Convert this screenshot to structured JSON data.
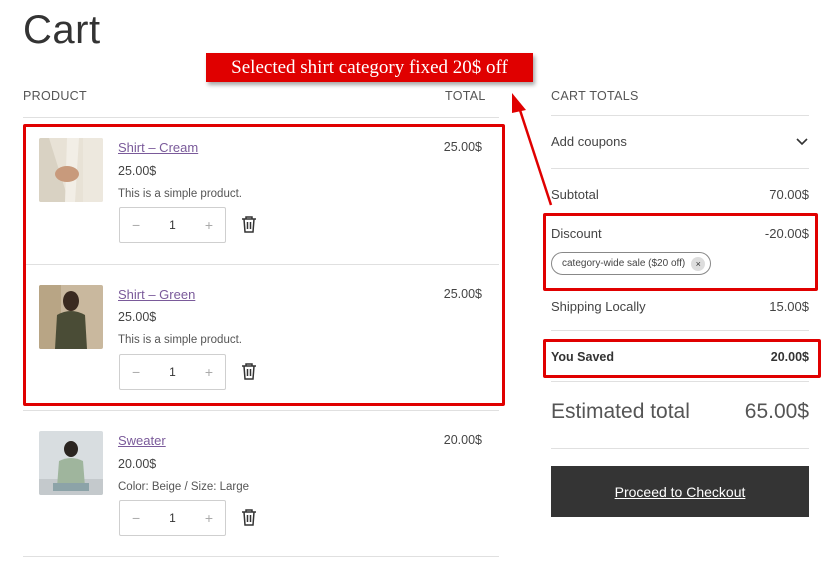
{
  "page": {
    "title": "Cart"
  },
  "headers": {
    "product": "PRODUCT",
    "total": "TOTAL",
    "cart_totals": "CART TOTALS"
  },
  "items": [
    {
      "name": "Shirt – Cream",
      "price": "25.00$",
      "desc": "This is a simple product.",
      "total": "25.00$",
      "qty": "1",
      "image": "cream-shirt-photo"
    },
    {
      "name": "Shirt – Green",
      "price": "25.00$",
      "desc": "This is a simple product.",
      "total": "25.00$",
      "qty": "1",
      "image": "green-shirt-photo"
    },
    {
      "name": "Sweater",
      "price": "20.00$",
      "desc": "Color: Beige / Size: Large",
      "total": "20.00$",
      "qty": "1",
      "image": "sweater-photo"
    }
  ],
  "qty_controls": {
    "minus": "−",
    "plus": "+"
  },
  "totals": {
    "coupons_label": "Add coupons",
    "subtotal_label": "Subtotal",
    "subtotal_value": "70.00$",
    "discount_label": "Discount",
    "discount_value": "-20.00$",
    "coupon_chip": "category-wide sale ($20 off)",
    "coupon_remove": "×",
    "shipping_label": "Shipping Locally",
    "shipping_value": "15.00$",
    "saved_label": "You Saved",
    "saved_value": "20.00$",
    "estimated_label": "Estimated total",
    "estimated_value": "65.00$"
  },
  "checkout": {
    "label": "Proceed to Checkout"
  },
  "annotation": {
    "text": "Selected shirt category fixed 20$ off",
    "color": "#e00000"
  }
}
